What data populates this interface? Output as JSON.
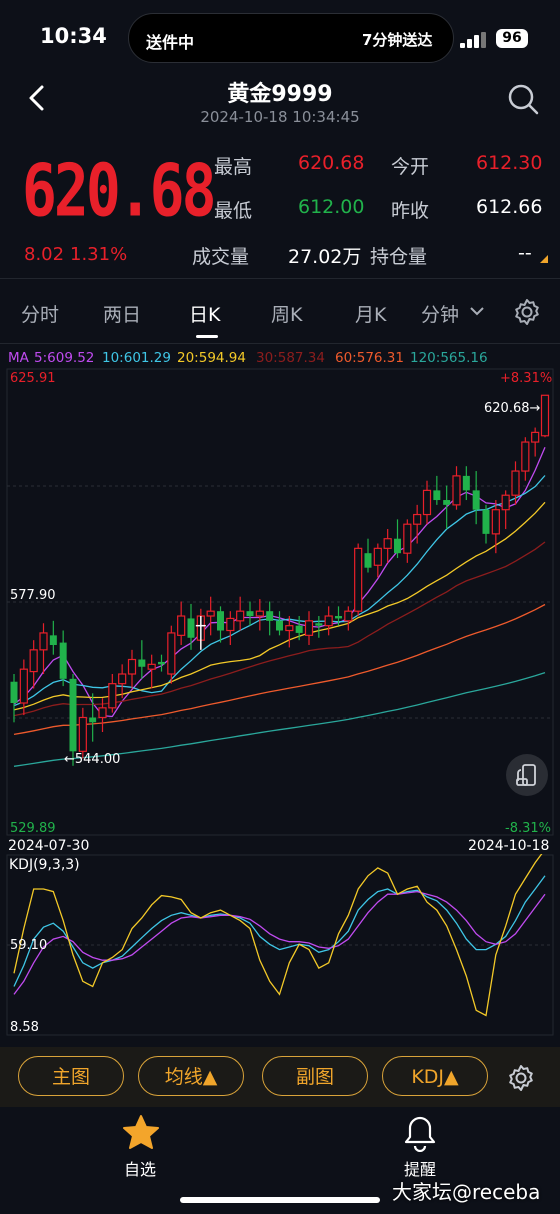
{
  "status_bar": {
    "time": "10:34",
    "island_left": "送件中",
    "island_right": "7分钟送达",
    "battery": "96"
  },
  "header": {
    "title": "黄金9999",
    "datetime": "2024-10-18 10:34:45"
  },
  "quote": {
    "price": "620.68",
    "change": "8.02",
    "change_pct": "1.31%",
    "high_label": "最高",
    "high": "620.68",
    "open_label": "今开",
    "open": "612.30",
    "low_label": "最低",
    "low": "612.00",
    "prev_close_label": "昨收",
    "prev_close": "612.66",
    "volume_label": "成交量",
    "volume": "27.02万",
    "position_label": "持仓量",
    "position": "--"
  },
  "tabs": [
    "分时",
    "两日",
    "日K",
    "周K",
    "月K",
    "分钟"
  ],
  "active_tab": "日K",
  "ma": {
    "prefix": "MA",
    "ma5": "5:609.52",
    "ma10": "10:601.29",
    "ma20": "20:594.94",
    "ma30": "30:587.34",
    "ma60": "60:576.31",
    "ma120": "120:565.16"
  },
  "main_chart": {
    "top_price": "625.91",
    "top_pct": "+8.31%",
    "mid_price": "577.90",
    "bottom_price": "529.89",
    "bottom_pct": "-8.31%",
    "last_price_marker": "620.68→",
    "low_marker": "←544.00",
    "start_date": "2024-07-30",
    "end_date": "2024-10-18"
  },
  "sub_chart": {
    "title": "KDJ(9,3,3)",
    "level_mid": "59.10",
    "level_low": "8.58"
  },
  "bottom_buttons": {
    "main": "主图",
    "ma": "均线▲",
    "sub": "副图",
    "kdj": "KDJ▲"
  },
  "nav": {
    "watchlist": "自选",
    "alerts": "提醒"
  },
  "watermark": "大家坛@receba",
  "colors": {
    "up": "#e8202a",
    "down": "#21b24b",
    "accent": "#f0a52b",
    "ma5": "#c04bf0",
    "ma10": "#3fc6e6",
    "ma20": "#f3c928",
    "ma30": "#8c1d1d",
    "ma60": "#ee5a2c",
    "ma120": "#2aa79b"
  },
  "chart_data": {
    "type": "candlestick",
    "title": "",
    "ylim": [
      529.89,
      625.91
    ],
    "x_range": [
      "2024-07-30",
      "2024-10-18"
    ],
    "candles": [
      [
        561.4,
        563.0,
        553.0,
        557.0
      ],
      [
        557.0,
        566.0,
        554.5,
        564.0
      ],
      [
        563.5,
        570.0,
        560.0,
        568.0
      ],
      [
        568.0,
        573.5,
        563.0,
        571.5
      ],
      [
        571.0,
        574.0,
        567.0,
        569.0
      ],
      [
        569.5,
        572.0,
        560.5,
        562.0
      ],
      [
        562.0,
        563.0,
        544.0,
        547.0
      ],
      [
        547.0,
        556.0,
        545.5,
        554.0
      ],
      [
        554.0,
        559.0,
        549.0,
        553.0
      ],
      [
        554.0,
        558.0,
        551.0,
        556.0
      ],
      [
        556.0,
        563.0,
        555.0,
        561.0
      ],
      [
        561.0,
        565.0,
        558.0,
        563.0
      ],
      [
        563.0,
        568.0,
        560.0,
        566.0
      ],
      [
        566.0,
        570.0,
        562.0,
        564.5
      ],
      [
        564.0,
        567.0,
        560.0,
        565.0
      ],
      [
        565.5,
        567.0,
        563.5,
        565.0
      ],
      [
        563.0,
        573.0,
        561.0,
        571.5
      ],
      [
        571.0,
        578.0,
        569.0,
        575.0
      ],
      [
        574.5,
        577.5,
        568.0,
        570.5
      ],
      [
        570.0,
        576.5,
        568.0,
        575.0
      ],
      [
        575.0,
        579.0,
        571.0,
        576.0
      ],
      [
        576.0,
        577.0,
        569.5,
        572.0
      ],
      [
        572.0,
        576.0,
        569.0,
        574.5
      ],
      [
        574.0,
        579.0,
        572.0,
        576.0
      ],
      [
        576.0,
        578.0,
        573.0,
        575.0
      ],
      [
        575.0,
        578.5,
        572.0,
        576.0
      ],
      [
        576.0,
        578.0,
        571.0,
        574.0
      ],
      [
        574.0,
        576.0,
        571.0,
        572.0
      ],
      [
        572.0,
        575.0,
        568.5,
        573.0
      ],
      [
        573.0,
        575.0,
        570.0,
        571.5
      ],
      [
        571.0,
        576.0,
        569.0,
        574.0
      ],
      [
        573.5,
        575.0,
        570.5,
        573.0
      ],
      [
        573.0,
        577.0,
        571.0,
        575.0
      ],
      [
        575.0,
        577.0,
        573.0,
        574.5
      ],
      [
        574.0,
        577.0,
        572.0,
        576.0
      ],
      [
        576.0,
        590.0,
        575.0,
        589.0
      ],
      [
        588.0,
        591.0,
        584.0,
        585.0
      ],
      [
        585.5,
        590.0,
        583.0,
        589.0
      ],
      [
        589.0,
        593.0,
        586.0,
        591.0
      ],
      [
        591.0,
        595.0,
        587.0,
        588.0
      ],
      [
        588.0,
        595.0,
        586.0,
        594.0
      ],
      [
        594.0,
        598.0,
        590.0,
        596.0
      ],
      [
        596.0,
        603.0,
        594.0,
        601.0
      ],
      [
        601.0,
        604.0,
        598.0,
        599.0
      ],
      [
        599.0,
        602.0,
        593.0,
        598.0
      ],
      [
        598.0,
        606.0,
        597.0,
        604.0
      ],
      [
        604.0,
        606.0,
        599.0,
        601.0
      ],
      [
        601.0,
        605.0,
        594.0,
        597.0
      ],
      [
        597.0,
        598.0,
        590.0,
        592.0
      ],
      [
        592.0,
        599.0,
        588.0,
        597.0
      ],
      [
        597.0,
        601.0,
        593.0,
        600.0
      ],
      [
        600.0,
        607.0,
        598.0,
        605.0
      ],
      [
        605.0,
        612.0,
        603.0,
        611.0
      ],
      [
        611.0,
        614.0,
        608.0,
        613.0
      ],
      [
        612.3,
        620.68,
        612.0,
        620.68
      ]
    ],
    "kdj_ylim": [
      -10,
      125
    ],
    "kdj": {
      "K": [
        26,
        42,
        62,
        71,
        74,
        68,
        56,
        44,
        40,
        44,
        46,
        49,
        56,
        63,
        70,
        76,
        80,
        82,
        80,
        78,
        80,
        81,
        80,
        78,
        74,
        64,
        58,
        54,
        56,
        58,
        57,
        52,
        54,
        60,
        68,
        84,
        92,
        98,
        100,
        96,
        98,
        99,
        94,
        91,
        84,
        74,
        62,
        54,
        54,
        58,
        64,
        76,
        90,
        100,
        110
      ],
      "D": [
        20,
        30,
        44,
        56,
        62,
        64,
        60,
        52,
        48,
        46,
        46,
        47,
        50,
        56,
        62,
        68,
        74,
        78,
        79,
        78,
        79,
        80,
        80,
        79,
        77,
        72,
        66,
        62,
        60,
        60,
        59,
        56,
        55,
        57,
        62,
        72,
        82,
        90,
        96,
        96,
        97,
        98,
        96,
        94,
        90,
        84,
        76,
        66,
        60,
        58,
        60,
        66,
        76,
        86,
        96
      ],
      "J": [
        36,
        70,
        100,
        100,
        98,
        76,
        50,
        30,
        26,
        44,
        48,
        54,
        70,
        78,
        88,
        95,
        94,
        92,
        82,
        78,
        82,
        84,
        80,
        76,
        70,
        46,
        30,
        20,
        44,
        58,
        54,
        40,
        44,
        66,
        80,
        100,
        110,
        116,
        112,
        96,
        100,
        102,
        90,
        84,
        72,
        54,
        34,
        8,
        4,
        50,
        72,
        96,
        108,
        120,
        130
      ]
    }
  }
}
